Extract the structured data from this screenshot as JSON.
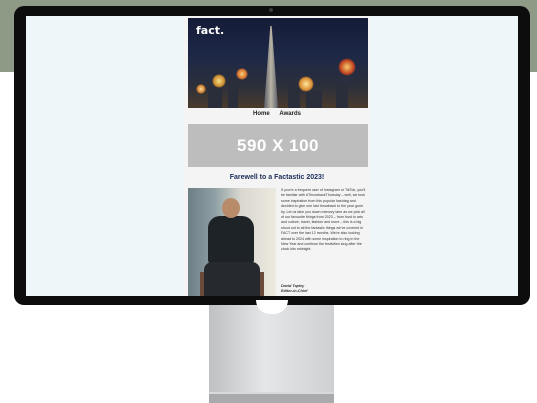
{
  "email": {
    "logo": "fact.",
    "nav": [
      "Home",
      "Awards"
    ],
    "banner_text": "590 X 100",
    "heading": "Farewell to a Factastic 2023!",
    "body_text": "If you're a frequent user of Instagram or TikTok, you'll be familiar with #ThrowbackThursday – well, we took some inspiration from this popular hashtag and decided to give one last throwback to the year gone by. Let us take you down memory lane as we pick all of our favourite things from 2023 – from food to arts and culture, travel, fashion and more – this is a big shout out to all the fantastic things we've covered in FACT over the last 12 months. We're also looking ahead to 2024 with some inspiration to ring in the New Year and continue the festivities long after the clock hits midnight.",
    "signature_name": "David Tapley",
    "signature_title": "Editor-in-Chief"
  },
  "colors": {
    "background_band": "#8e9a86",
    "heading": "#1c2d5a",
    "banner": "#bdbdbd"
  }
}
